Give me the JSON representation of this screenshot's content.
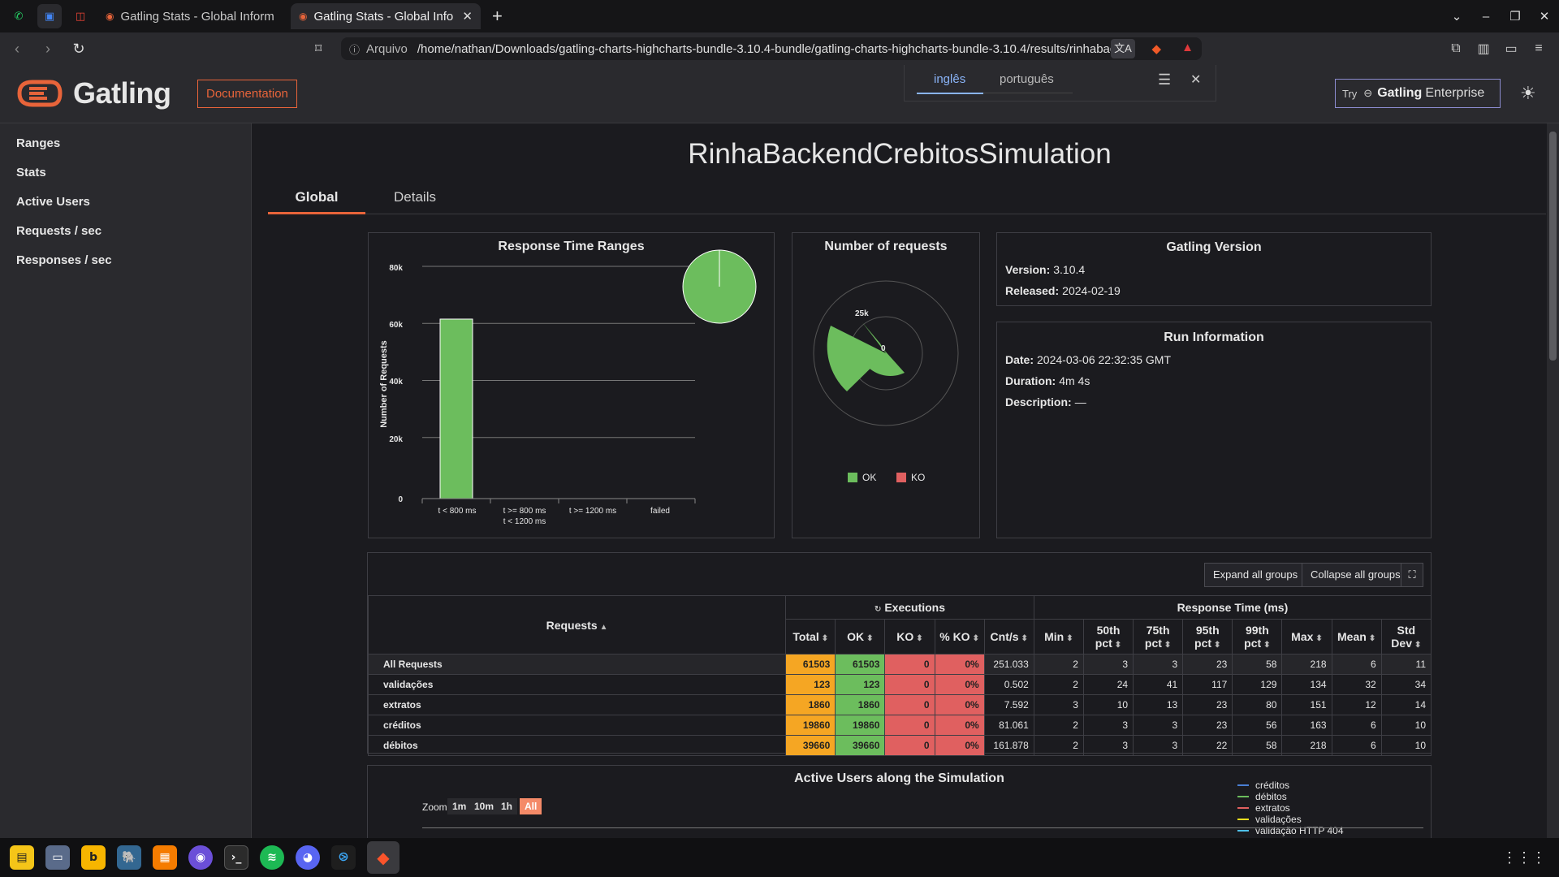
{
  "browser": {
    "tabs": [
      {
        "title": "Gatling Stats - Global Inform"
      },
      {
        "title": "Gatling Stats - Global Info"
      }
    ],
    "url_scheme": "Arquivo",
    "url_path": "/home/nathan/Downloads/gatling-charts-highcharts-bundle-3.10.4-bundle/gatling-charts-highcharts-bundle-3.10.4/results/rinhabacken…",
    "translate_popup": {
      "lang1": "inglês",
      "lang2": "português"
    }
  },
  "header": {
    "brand": "Gatling",
    "doc_button": "Documentation",
    "try_prefix": "Try",
    "try_brand": "Gatling",
    "try_suffix": "Enterprise"
  },
  "sidebar": {
    "items": [
      {
        "label": "Ranges"
      },
      {
        "label": "Stats"
      },
      {
        "label": "Active Users"
      },
      {
        "label": "Requests / sec"
      },
      {
        "label": "Responses / sec"
      }
    ]
  },
  "main": {
    "title": "RinhaBackendCrebitosSimulation",
    "tabs": [
      {
        "label": "Global"
      },
      {
        "label": "Details"
      }
    ]
  },
  "response_time_panel": {
    "title": "Response Time Ranges",
    "ylabel": "Number of Requests",
    "yticks": [
      "80k",
      "60k",
      "40k",
      "20k",
      "0"
    ],
    "categories": [
      "t < 800 ms",
      "t >= 800 ms",
      "t < 1200 ms",
      "t >= 1200 ms",
      "failed"
    ]
  },
  "requests_panel": {
    "title": "Number of requests",
    "tick_25k": "25k",
    "tick_0": "0",
    "legend_ok": "OK",
    "legend_ko": "KO"
  },
  "version_panel": {
    "title": "Gatling Version",
    "version_label": "Version:",
    "version_value": "3.10.4",
    "released_label": "Released:",
    "released_value": "2024-02-19"
  },
  "run_panel": {
    "title": "Run Information",
    "date_label": "Date:",
    "date_value": "2024-03-06 22:32:35 GMT",
    "duration_label": "Duration:",
    "duration_value": "4m 4s",
    "description_label": "Description:",
    "description_value": "—"
  },
  "stats": {
    "expand_button": "Expand all groups",
    "collapse_button": "Collapse all groups",
    "col_requests": "Requests",
    "col_executions": "Executions",
    "col_response_time": "Response Time (ms)",
    "columns": [
      "Total",
      "OK",
      "KO",
      "% KO",
      "Cnt/s",
      "Min",
      "50th pct",
      "75th pct",
      "95th pct",
      "99th pct",
      "Max",
      "Mean",
      "Std Dev"
    ],
    "rows": [
      {
        "name": "All Requests",
        "total": "61503",
        "ok": "61503",
        "ko": "0",
        "pko": "0%",
        "cnt": "251.033",
        "min": "2",
        "p50": "3",
        "p75": "3",
        "p95": "23",
        "p99": "58",
        "max": "218",
        "mean": "6",
        "std": "11"
      },
      {
        "name": "validações",
        "total": "123",
        "ok": "123",
        "ko": "0",
        "pko": "0%",
        "cnt": "0.502",
        "min": "2",
        "p50": "24",
        "p75": "41",
        "p95": "117",
        "p99": "129",
        "max": "134",
        "mean": "32",
        "std": "34"
      },
      {
        "name": "extratos",
        "total": "1860",
        "ok": "1860",
        "ko": "0",
        "pko": "0%",
        "cnt": "7.592",
        "min": "3",
        "p50": "10",
        "p75": "13",
        "p95": "23",
        "p99": "80",
        "max": "151",
        "mean": "12",
        "std": "14"
      },
      {
        "name": "créditos",
        "total": "19860",
        "ok": "19860",
        "ko": "0",
        "pko": "0%",
        "cnt": "81.061",
        "min": "2",
        "p50": "3",
        "p75": "3",
        "p95": "23",
        "p99": "56",
        "max": "163",
        "mean": "6",
        "std": "10"
      },
      {
        "name": "débitos",
        "total": "39660",
        "ok": "39660",
        "ko": "0",
        "pko": "0%",
        "cnt": "161.878",
        "min": "2",
        "p50": "3",
        "p75": "3",
        "p95": "22",
        "p99": "58",
        "max": "218",
        "mean": "6",
        "std": "10"
      }
    ]
  },
  "active_users_panel": {
    "title": "Active Users along the Simulation",
    "zoom_label": "Zoom",
    "zoom_buttons": [
      "1m",
      "10m",
      "1h",
      "All"
    ],
    "legend": [
      {
        "name": "créditos",
        "color": "#4a7fd4"
      },
      {
        "name": "débitos",
        "color": "#6cbd5d"
      },
      {
        "name": "extratos",
        "color": "#e06060"
      },
      {
        "name": "validações",
        "color": "#f0e020"
      },
      {
        "name": "validação HTTP 404",
        "color": "#4ec0e8"
      }
    ]
  },
  "chart_data": [
    {
      "type": "bar",
      "title": "Response Time Ranges",
      "ylabel": "Number of Requests",
      "categories": [
        "t < 800 ms",
        "t >= 800 ms t < 1200 ms",
        "t >= 1200 ms",
        "failed"
      ],
      "values": [
        61503,
        0,
        0,
        0
      ],
      "ylim": [
        0,
        80000
      ],
      "color": "#6cbd5d",
      "inset_pie": [
        {
          "name": "t < 800 ms",
          "value": 100
        }
      ]
    },
    {
      "type": "pie",
      "title": "Number of requests",
      "polar": true,
      "series": [
        {
          "name": "OK",
          "color": "#6cbd5d"
        },
        {
          "name": "KO",
          "color": "#e06060"
        }
      ]
    }
  ],
  "colors": {
    "accent": "#e8643a",
    "ok": "#6cbd5d",
    "ko": "#e06060",
    "total": "#f5a623"
  }
}
